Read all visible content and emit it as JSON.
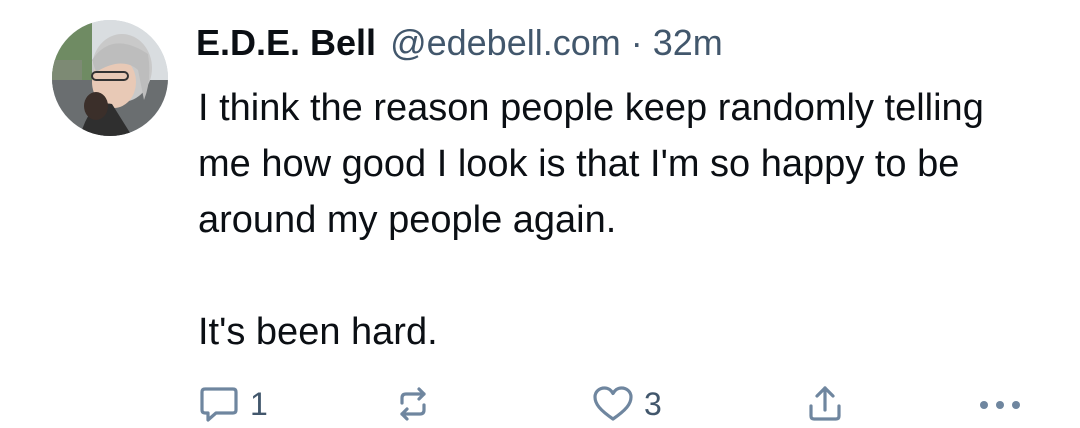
{
  "post": {
    "author_name": "E.D.E. Bell",
    "author_handle": "@edebell.com",
    "separator": "·",
    "timestamp": "32m",
    "paragraphs": [
      "I think the reason people keep randomly telling me how good I look is that I'm so happy to be around my people again.",
      "It's been hard."
    ]
  },
  "actions": {
    "reply": {
      "icon": "reply-icon",
      "count": "1"
    },
    "repost": {
      "icon": "repost-icon",
      "count": ""
    },
    "like": {
      "icon": "heart-icon",
      "count": "3"
    },
    "share": {
      "icon": "share-icon"
    },
    "more": {
      "icon": "more-options-icon"
    }
  },
  "colors": {
    "text": "#0b0f14",
    "muted": "#42576c",
    "icon": "#6f869f",
    "background": "#ffffff"
  }
}
